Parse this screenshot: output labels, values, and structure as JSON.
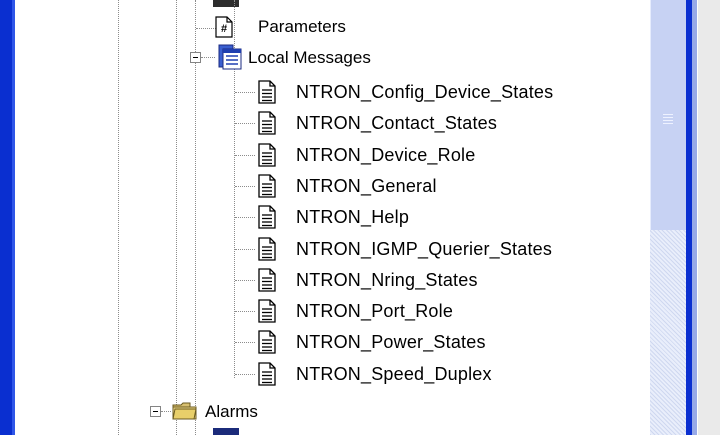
{
  "tree": {
    "parameters_label": "Parameters",
    "local_messages_label": "Local Messages",
    "messages": [
      "NTRON_Config_Device_States",
      "NTRON_Contact_States",
      "NTRON_Device_Role",
      "NTRON_General",
      "NTRON_Help",
      "NTRON_IGMP_Querier_States",
      "NTRON_Nring_States",
      "NTRON_Port_Role",
      "NTRON_Power_States",
      "NTRON_Speed_Duplex"
    ],
    "alarms_label": "Alarms"
  },
  "icons": {
    "parameters": "hash-document-icon",
    "local_messages": "message-table-icon",
    "message": "text-document-icon",
    "alarms": "folder-icon"
  },
  "colors": {
    "frame_blue": "#0a2fd0",
    "scroll_track": "#c7d2f3"
  }
}
